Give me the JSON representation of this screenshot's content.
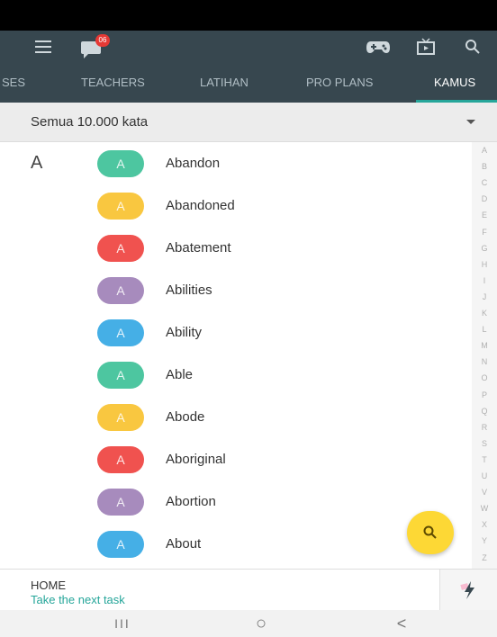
{
  "header": {
    "notification_count": "06",
    "icons": [
      "menu-icon",
      "chat-icon",
      "gamepad-icon",
      "tv-icon",
      "search-icon"
    ]
  },
  "tabs": [
    {
      "label": "SES",
      "active": false
    },
    {
      "label": "TEACHERS",
      "active": false
    },
    {
      "label": "LATIHAN",
      "active": false
    },
    {
      "label": "PRO PLANS",
      "active": false
    },
    {
      "label": "KAMUS",
      "active": true
    }
  ],
  "filter": {
    "selected": "Semua 10.000 kata"
  },
  "section_letter": "A",
  "words": [
    {
      "word": "Abandon",
      "initial": "A",
      "color": "#4dc6a0"
    },
    {
      "word": "Abandoned",
      "initial": "A",
      "color": "#f9c740"
    },
    {
      "word": "Abatement",
      "initial": "A",
      "color": "#f0524f"
    },
    {
      "word": "Abilities",
      "initial": "A",
      "color": "#a78bbd"
    },
    {
      "word": "Ability",
      "initial": "A",
      "color": "#45afe6"
    },
    {
      "word": "Able",
      "initial": "A",
      "color": "#4dc6a0"
    },
    {
      "word": "Abode",
      "initial": "A",
      "color": "#f9c740"
    },
    {
      "word": "Aboriginal",
      "initial": "A",
      "color": "#f0524f"
    },
    {
      "word": "Abortion",
      "initial": "A",
      "color": "#a78bbd"
    },
    {
      "word": "About",
      "initial": "A",
      "color": "#45afe6"
    }
  ],
  "alphabet": [
    "A",
    "B",
    "C",
    "D",
    "E",
    "F",
    "G",
    "H",
    "I",
    "J",
    "K",
    "L",
    "M",
    "N",
    "O",
    "P",
    "Q",
    "R",
    "S",
    "T",
    "U",
    "V",
    "W",
    "X",
    "Y",
    "Z"
  ],
  "bottom": {
    "home_label": "HOME",
    "task_text": "Take the next task"
  },
  "nav": {
    "recents": "III",
    "home": "○",
    "back": "<"
  },
  "colors": {
    "app_bar": "#37474f",
    "accent": "#26a69a",
    "fab": "#fdd835"
  }
}
